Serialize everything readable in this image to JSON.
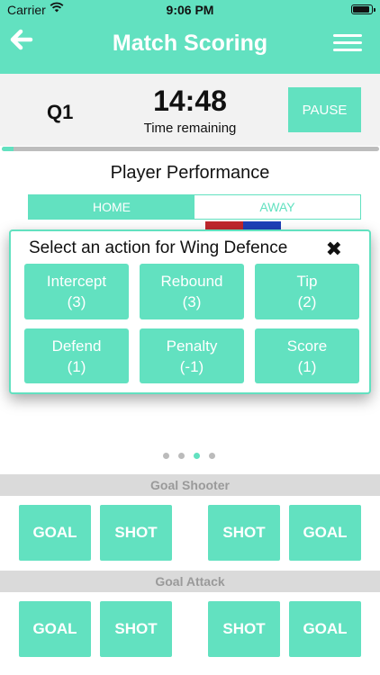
{
  "status_bar": {
    "carrier": "Carrier",
    "time": "9:06 PM"
  },
  "nav": {
    "title": "Match Scoring"
  },
  "timer": {
    "quarter": "Q1",
    "clock": "14:48",
    "clock_label": "Time  remaining",
    "pause_label": "PAUSE",
    "progress": 0.03
  },
  "performance": {
    "title": "Player Performance",
    "tabs": [
      {
        "label": "HOME",
        "active": true
      },
      {
        "label": "AWAY",
        "active": false
      }
    ]
  },
  "modal": {
    "title": "Select an action for Wing Defence",
    "actions": [
      {
        "label": "Intercept",
        "value": "(3)"
      },
      {
        "label": "Rebound",
        "value": "(3)"
      },
      {
        "label": "Tip",
        "value": "(2)"
      },
      {
        "label": "Defend",
        "value": "(1)"
      },
      {
        "label": "Penalty",
        "value": "(-1)"
      },
      {
        "label": "Score",
        "value": "(1)"
      }
    ]
  },
  "pager": {
    "count": 4,
    "active_index": 2
  },
  "positions": [
    {
      "name": "Goal Shooter",
      "buttons": [
        "GOAL",
        "SHOT",
        "SHOT",
        "GOAL"
      ]
    },
    {
      "name": "Goal Attack",
      "buttons": [
        "GOAL",
        "SHOT",
        "SHOT",
        "GOAL"
      ]
    }
  ],
  "colors": {
    "accent": "#62E1C0",
    "panel": "#F2F2F2",
    "section": "#DADADA",
    "away_red": "#C0272D",
    "away_blue": "#1E3FB8"
  },
  "icons": {
    "back": "arrow-left-icon",
    "menu": "hamburger-menu-icon",
    "close": "close-x-icon",
    "wifi": "wifi-icon",
    "battery": "battery-icon"
  }
}
